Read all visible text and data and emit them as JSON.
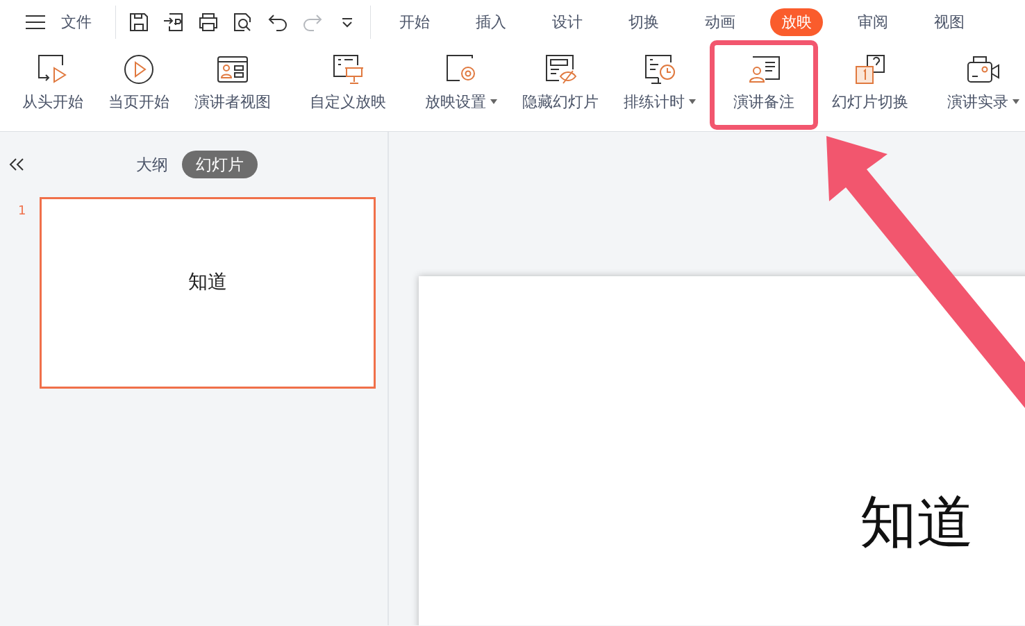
{
  "menubar": {
    "file_label": "文件",
    "quick_tools": [
      {
        "kind": "save"
      },
      {
        "kind": "export"
      },
      {
        "kind": "print"
      },
      {
        "kind": "preview"
      },
      {
        "kind": "undo"
      },
      {
        "kind": "redo"
      },
      {
        "kind": "more"
      }
    ],
    "tabs": [
      {
        "label": "开始",
        "selected": false
      },
      {
        "label": "插入",
        "selected": false
      },
      {
        "label": "设计",
        "selected": false
      },
      {
        "label": "切换",
        "selected": false
      },
      {
        "label": "动画",
        "selected": false
      },
      {
        "label": "放映",
        "selected": true
      },
      {
        "label": "审阅",
        "selected": false
      },
      {
        "label": "视图",
        "selected": false
      }
    ]
  },
  "ribbon": {
    "groups": [
      [
        {
          "label": "从头开始",
          "kind": "start",
          "dropdown": false,
          "highlighted": false
        },
        {
          "label": "当页开始",
          "kind": "play",
          "dropdown": false,
          "highlighted": false
        },
        {
          "label": "演讲者视图",
          "kind": "presenter",
          "dropdown": false,
          "highlighted": false
        }
      ],
      [
        {
          "label": "自定义放映",
          "kind": "custom",
          "dropdown": false,
          "highlighted": false
        }
      ],
      [
        {
          "label": "放映设置",
          "kind": "settings",
          "dropdown": true,
          "highlighted": false
        },
        {
          "label": "隐藏幻灯片",
          "kind": "hide",
          "dropdown": false,
          "highlighted": false
        },
        {
          "label": "排练计时",
          "kind": "timer",
          "dropdown": true,
          "highlighted": false
        },
        {
          "label": "演讲备注",
          "kind": "notes",
          "dropdown": false,
          "highlighted": true
        },
        {
          "label": "幻灯片切换",
          "kind": "switch",
          "dropdown": false,
          "highlighted": false
        }
      ],
      [
        {
          "label": "演讲实录",
          "kind": "record",
          "dropdown": true,
          "highlighted": false
        }
      ]
    ]
  },
  "pointer_arrow": true,
  "side_panel": {
    "view_tabs": [
      {
        "label": "大纲",
        "selected": false
      },
      {
        "label": "幻灯片",
        "selected": true
      }
    ],
    "slides": [
      {
        "number": "1",
        "title": "知道",
        "selected": true
      }
    ]
  },
  "slide": {
    "title": "知道"
  }
}
